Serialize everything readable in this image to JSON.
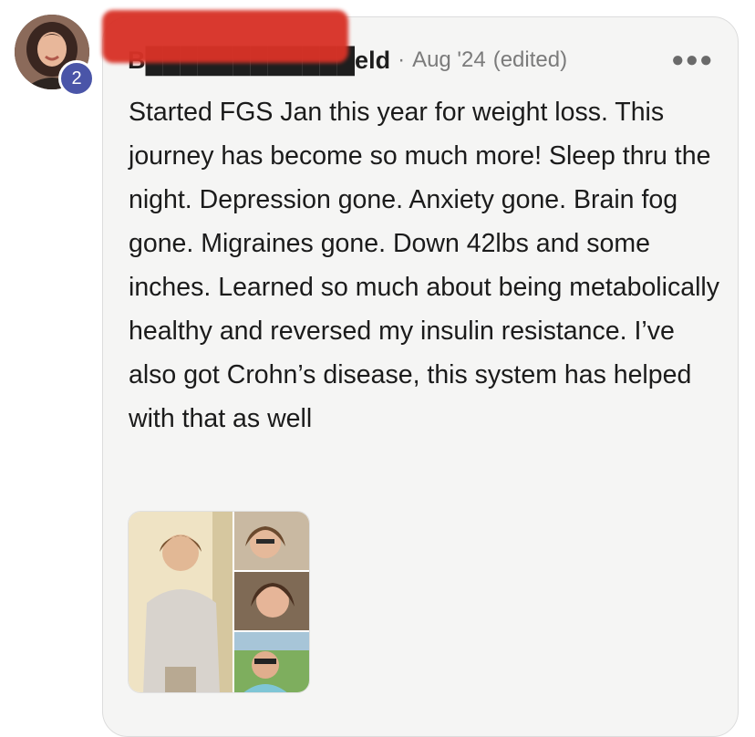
{
  "post": {
    "author": {
      "name": "B████████████eld",
      "badge": "2",
      "avatar_icon": "user-photo"
    },
    "separator": "·",
    "date": "Aug '24",
    "edited": "(edited)",
    "menu_icon": "more-horizontal-icon",
    "body": "Started FGS Jan this year for weight loss. This journey has become so much more! Sleep thru the night. Depression gone. Anxiety gone. Brain fog gone. Migraines gone. Down 42lbs and some inches. Learned so much about being metabolically healthy and reversed my insulin resistance. I’ve also got Crohn’s disease, this system has helped with that as well",
    "attachment": {
      "type": "photo-collage",
      "photos": 4
    }
  },
  "colors": {
    "badge": "#4a55a8",
    "card_bg": "#f5f5f4",
    "redaction": "#d83227",
    "meta_text": "#7b7b7b"
  }
}
